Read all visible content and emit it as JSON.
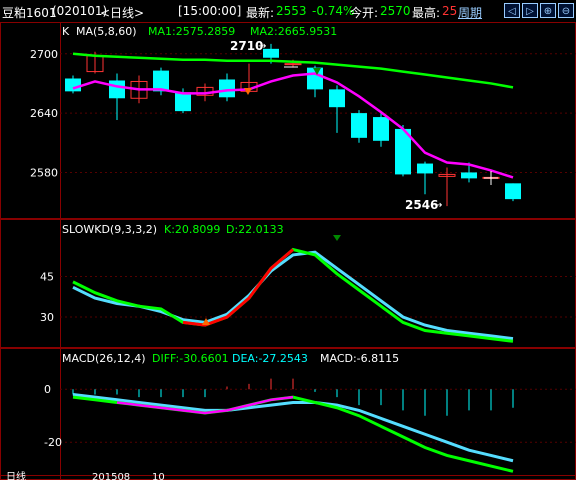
{
  "header": {
    "symbol": "豆粕1601",
    "code": "(020101)",
    "period": "<日线>",
    "time": "[15:00:00]",
    "latest_label": "最新:",
    "latest_value": "2553",
    "change_pct": "-0.74%",
    "open_label": "今开:",
    "open_value": "2570",
    "high_label": "最高:",
    "high_value": "25",
    "cycle_label": "周期",
    "nav": [
      "◁",
      "▷",
      "⊕",
      "⊖"
    ]
  },
  "main_legend": {
    "k": "K",
    "ma": "MA(5,8,60)",
    "ma1": "MA1:2575.2859",
    "ma2": "MA2:2665.9531"
  },
  "price_axis": [
    "2700",
    "2640",
    "2580"
  ],
  "annotations": {
    "high_mark": "2710",
    "low_mark": "2546"
  },
  "kd_legend": {
    "name": "SLOWKD(9,3,3,2)",
    "k": "K:20.8099",
    "d": "D:22.0133"
  },
  "kd_axis": [
    "45",
    "30"
  ],
  "macd_legend": {
    "name": "MACD(26,12,4)",
    "diff": "DIFF:-30.6601",
    "dea": "DEA:-27.2543",
    "macd": "MACD:-6.8115"
  },
  "macd_axis": [
    "0",
    "-20"
  ],
  "footer": {
    "label": "日线",
    "date": "201508",
    "x": "10"
  },
  "colors": {
    "up": "#ff3333",
    "down": "#00ffff",
    "ma1": "#ff00ff",
    "ma2": "#00ff00",
    "kd_k": "#ff0000",
    "kd_d": "#00ff00",
    "grid": "#880000",
    "legend_ma": "#ffffff"
  },
  "chart_data": {
    "type": "candlestick",
    "candles": [
      {
        "o": 2675,
        "c": 2662,
        "h": 2678,
        "l": 2660
      },
      {
        "o": 2682,
        "c": 2698,
        "h": 2702,
        "l": 2680
      },
      {
        "o": 2673,
        "c": 2655,
        "h": 2680,
        "l": 2633
      },
      {
        "o": 2655,
        "c": 2672,
        "h": 2678,
        "l": 2650
      },
      {
        "o": 2683,
        "c": 2662,
        "h": 2686,
        "l": 2658
      },
      {
        "o": 2661,
        "c": 2642,
        "h": 2665,
        "l": 2640
      },
      {
        "o": 2658,
        "c": 2666,
        "h": 2670,
        "l": 2652
      },
      {
        "o": 2674,
        "c": 2656,
        "h": 2680,
        "l": 2652
      },
      {
        "o": 2662,
        "c": 2671,
        "h": 2690,
        "l": 2661
      },
      {
        "o": 2705,
        "c": 2696,
        "h": 2710,
        "l": 2690
      },
      {
        "o": 2690,
        "c": 2690,
        "h": 2694,
        "l": 2686
      },
      {
        "o": 2686,
        "c": 2664,
        "h": 2688,
        "l": 2656
      },
      {
        "o": 2664,
        "c": 2646,
        "h": 2668,
        "l": 2620
      },
      {
        "o": 2640,
        "c": 2615,
        "h": 2643,
        "l": 2610
      },
      {
        "o": 2636,
        "c": 2612,
        "h": 2640,
        "l": 2606
      },
      {
        "o": 2624,
        "c": 2578,
        "h": 2628,
        "l": 2576
      },
      {
        "o": 2589,
        "c": 2579,
        "h": 2591,
        "l": 2558
      },
      {
        "o": 2576,
        "c": 2578,
        "h": 2585,
        "l": 2546
      },
      {
        "o": 2580,
        "c": 2574,
        "h": 2590,
        "l": 2570
      },
      {
        "o": 2575,
        "c": 2575,
        "h": 2580,
        "l": 2568
      },
      {
        "o": 2569,
        "c": 2553,
        "h": 2569,
        "l": 2551
      }
    ],
    "ma1": [
      2665,
      2672,
      2667,
      2664,
      2664,
      2660,
      2660,
      2663,
      2664,
      2672,
      2678,
      2680,
      2671,
      2657,
      2641,
      2624,
      2600,
      2590,
      2588,
      2582,
      2575
    ],
    "ma2": [
      2700,
      2698,
      2697,
      2696,
      2695,
      2694,
      2694,
      2693,
      2693,
      2693,
      2692,
      2691,
      2689,
      2687,
      2685,
      2682,
      2679,
      2676,
      2673,
      2670,
      2666
    ],
    "kd_k": [
      43,
      39,
      36,
      34,
      33,
      28,
      27,
      30,
      37,
      48,
      55,
      53,
      46,
      40,
      34,
      28,
      25,
      24,
      23,
      22,
      21
    ],
    "kd_d": [
      41,
      37,
      35,
      34,
      32,
      29,
      28,
      31,
      38,
      47,
      53,
      54,
      48,
      42,
      36,
      30,
      27,
      25,
      24,
      23,
      22
    ],
    "macd_diff": [
      -3,
      -4,
      -5,
      -6,
      -7,
      -8,
      -9,
      -8,
      -6,
      -4,
      -3,
      -5,
      -7,
      -10,
      -14,
      -18,
      -22,
      -25,
      -27,
      -29,
      -31
    ],
    "macd_dea": [
      -2,
      -3,
      -4,
      -5,
      -6,
      -7,
      -8,
      -8,
      -7,
      -6,
      -5,
      -5,
      -6,
      -8,
      -11,
      -14,
      -17,
      -20,
      -23,
      -25,
      -27
    ],
    "macd_bar": [
      -2,
      -2,
      -2,
      -3,
      -3,
      -3,
      -3,
      1,
      2,
      4,
      4,
      -1,
      -3,
      -6,
      -6,
      -8,
      -10,
      -10,
      -8,
      -8,
      -7
    ],
    "ylim_price": [
      2540,
      2720
    ],
    "ylim_kd": [
      20,
      60
    ],
    "ylim_macd": [
      -32,
      8
    ]
  }
}
